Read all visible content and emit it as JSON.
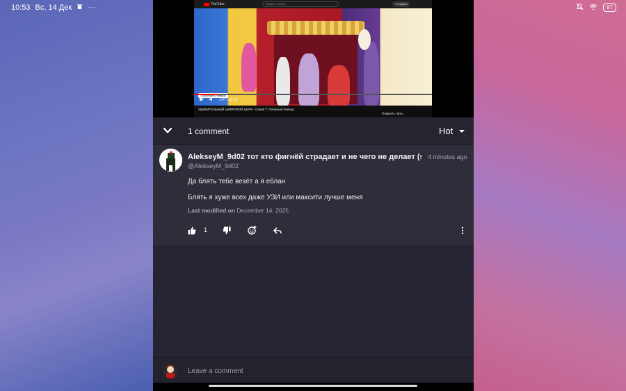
{
  "status_bar": {
    "time": "10:53",
    "date": "Вс, 14 Дек",
    "overflow": "···",
    "battery": "97"
  },
  "video": {
    "site": "YouTube",
    "search_placeholder": "Введите запрос",
    "create_label": "+ Создать",
    "title": "УДИВИТЕЛЬНЫЙ ЦИФРОВОЙ ЦИРК - Серия 7: Пляжный Эпизод",
    "time": "1:47 / 22:53",
    "chip_label": "Посмотреть товары",
    "side_label": "Показать чаты",
    "progress": 0.1
  },
  "comments_header": {
    "count_label": "1 comment",
    "sort_label": "Hot"
  },
  "comment": {
    "author": "AlekseyM_9d02 тот кто фигнёй страдает и не чего не делает (sus",
    "handle": "@AlekseyM_9d02",
    "time": "4 minutes ago",
    "line1": "Да блять тебе везёт а я еблан",
    "line2": "Блять я хуже всех даже УЗИ или максити лучше меня",
    "modified_label": "Last modified on",
    "modified_date": "December 14, 2025",
    "likes": "1"
  },
  "footer": {
    "placeholder": "Leave a comment"
  },
  "icons": {
    "like": "thumb-up-icon",
    "dislike": "thumb-down-icon",
    "react": "add-reaction-icon",
    "reply": "reply-icon",
    "more": "more-vertical-icon",
    "collapse": "chevron-down-icon"
  },
  "colors": {
    "panel": "#262433",
    "comment_bg": "#2f2d39",
    "text": "#ececec",
    "muted": "#a8a6b4"
  }
}
